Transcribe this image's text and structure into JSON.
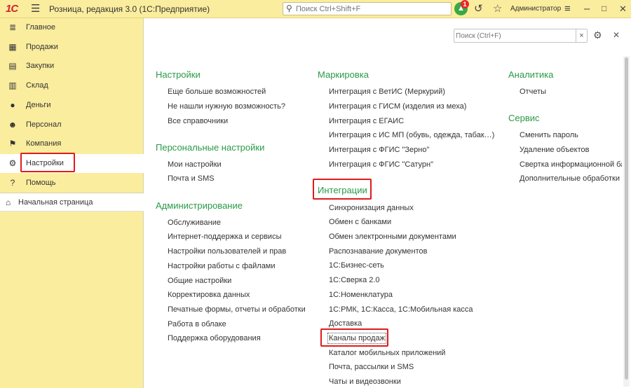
{
  "titlebar": {
    "logo": "1С",
    "app_title": "Розница, редакция 3.0  (1С:Предприятие)",
    "search_placeholder": "Поиск Ctrl+Shift+F",
    "notification_count": "1",
    "user": "Администратор"
  },
  "sidebar": {
    "items": [
      {
        "label": "Главное",
        "icon": "menu-lines-icon"
      },
      {
        "label": "Продажи",
        "icon": "cash-register-icon"
      },
      {
        "label": "Закупки",
        "icon": "cart-icon"
      },
      {
        "label": "Склад",
        "icon": "warehouse-icon"
      },
      {
        "label": "Деньги",
        "icon": "money-icon"
      },
      {
        "label": "Персонал",
        "icon": "people-icon"
      },
      {
        "label": "Компания",
        "icon": "flag-icon"
      },
      {
        "label": "Настройки",
        "icon": "gear-icon"
      },
      {
        "label": "Помощь",
        "icon": "help-icon"
      }
    ],
    "home": "Начальная страница"
  },
  "main": {
    "search_placeholder": "Поиск (Ctrl+F)",
    "columns": [
      {
        "sections": [
          {
            "title": "Настройки",
            "links": [
              "Еще больше возможностей",
              "Не нашли нужную возможность?",
              "Все справочники"
            ]
          },
          {
            "title": "Персональные настройки",
            "links": [
              "Мои настройки",
              "Почта и SMS"
            ]
          },
          {
            "title": "Администрирование",
            "links": [
              "Обслуживание",
              "Интернет-поддержка и сервисы",
              "Настройки пользователей и прав",
              "Настройки работы с файлами",
              "Общие настройки",
              "Корректировка данных",
              "Печатные формы, отчеты и обработки",
              "Работа в облаке",
              "Поддержка оборудования"
            ]
          }
        ]
      },
      {
        "sections": [
          {
            "title": "Маркировка",
            "links": [
              "Интеграция с ВетИС (Меркурий)",
              "Интеграция с ГИСМ (изделия из меха)",
              "Интеграция с ЕГАИС",
              "Интеграция с ИС МП (обувь, одежда, табак…)",
              "Интеграция с ФГИС \"Зерно\"",
              "Интеграция с ФГИС \"Сатурн\""
            ]
          },
          {
            "title": "Интеграции",
            "links": [
              "Синхронизация данных",
              "Обмен с банками",
              "Обмен электронными документами",
              "Распознавание документов",
              "1С:Бизнес-сеть",
              "1С:Сверка 2.0",
              "1С:Номенклатура",
              "1С:РМК, 1С:Касса, 1С:Мобильная касса",
              "Доставка",
              "Каналы продаж",
              "Каталог мобильных приложений",
              "Почта, рассылки и SMS",
              "Чаты и видеозвонки"
            ]
          }
        ]
      },
      {
        "sections": [
          {
            "title": "Аналитика",
            "links": [
              "Отчеты"
            ]
          },
          {
            "title": "Сервис",
            "links": [
              "Сменить пароль",
              "Удаление объектов",
              "Свертка информационной базы",
              "Дополнительные обработки"
            ]
          }
        ]
      }
    ]
  },
  "colors": {
    "panel": "#fbed9e",
    "section_heading": "#2a9a47",
    "highlight_box": "#e01b1b"
  }
}
